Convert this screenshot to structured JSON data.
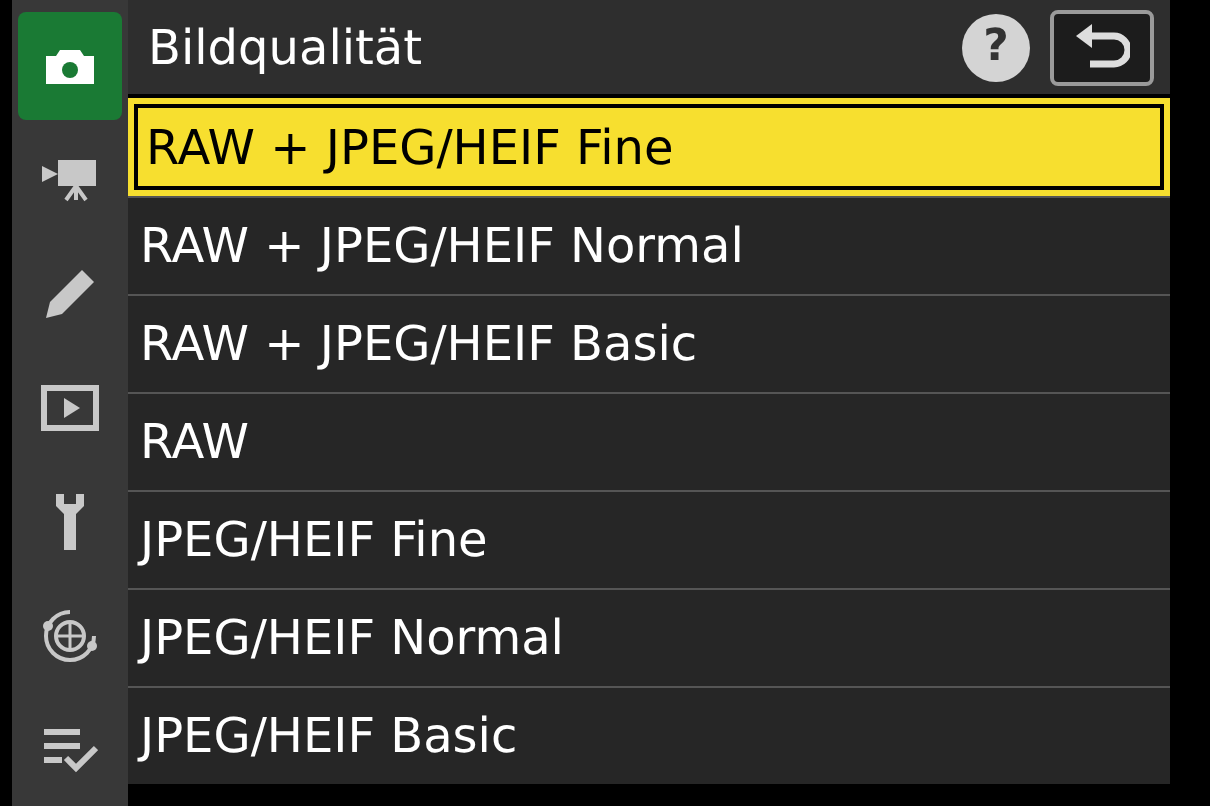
{
  "sidebar": {
    "items": [
      {
        "selected": true
      },
      {
        "selected": false
      },
      {
        "selected": false
      },
      {
        "selected": false
      },
      {
        "selected": false
      },
      {
        "selected": false
      },
      {
        "selected": false
      }
    ]
  },
  "header": {
    "title": "Bildqualität",
    "help": "?"
  },
  "options": [
    {
      "label": "RAW + JPEG/HEIF Fine",
      "selected": true
    },
    {
      "label": "RAW + JPEG/HEIF Normal",
      "selected": false
    },
    {
      "label": "RAW + JPEG/HEIF Basic",
      "selected": false
    },
    {
      "label": "RAW",
      "selected": false
    },
    {
      "label": "JPEG/HEIF Fine",
      "selected": false
    },
    {
      "label": "JPEG/HEIF Normal",
      "selected": false
    },
    {
      "label": "JPEG/HEIF Basic",
      "selected": false
    }
  ]
}
